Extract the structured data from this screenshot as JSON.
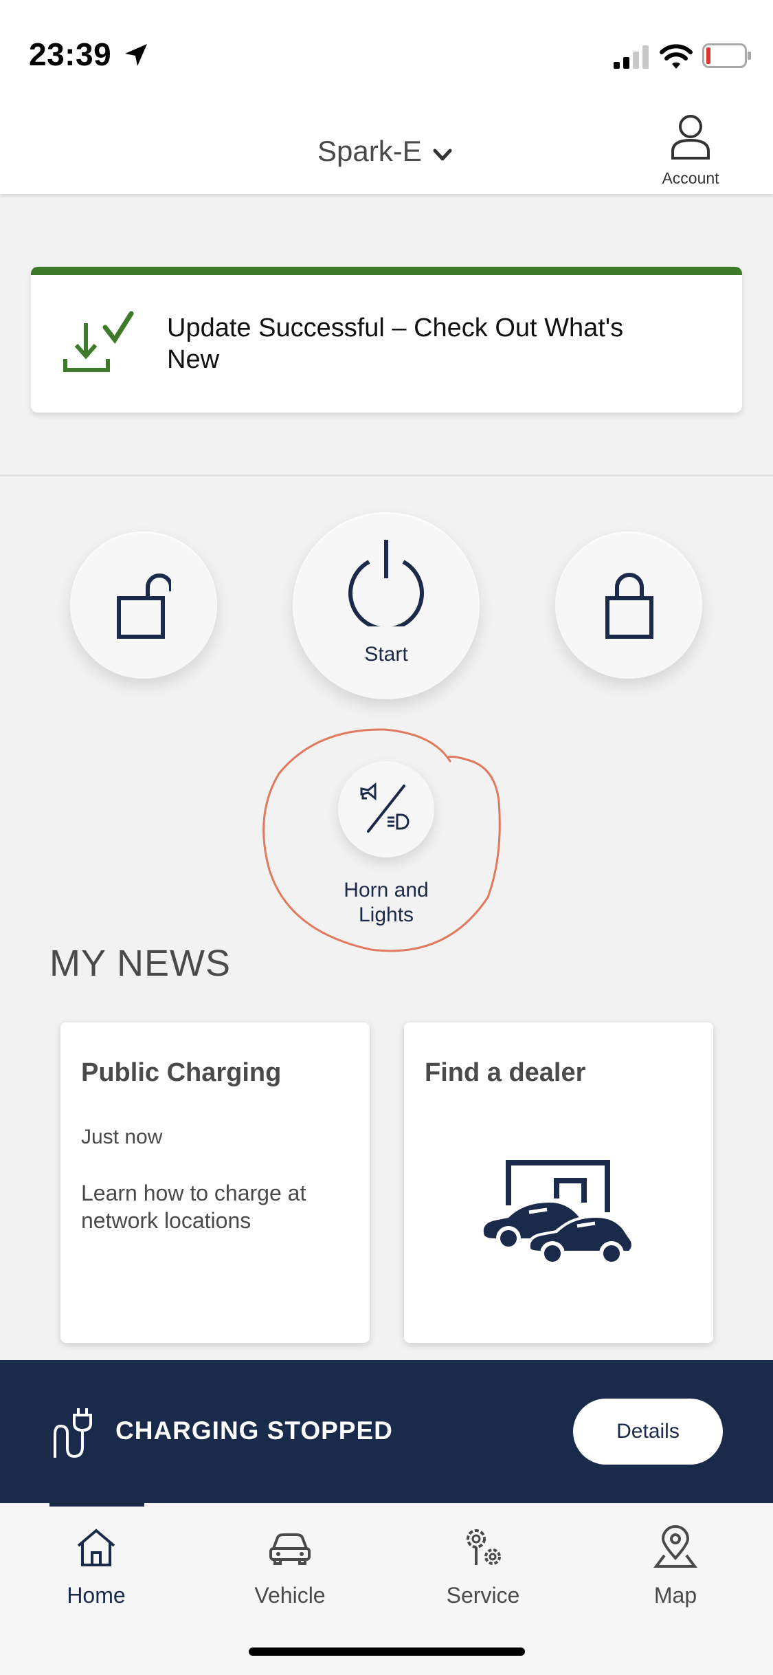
{
  "status_bar": {
    "time": "23:39",
    "icons": [
      "location-arrow-icon",
      "cellular-signal-icon",
      "wifi-icon",
      "battery-low-icon"
    ]
  },
  "header": {
    "vehicle_name": "Spark-E",
    "account_label": "Account"
  },
  "update_banner": {
    "text": "Update Successful – Check Out What's New",
    "accent_color": "#3d7a29",
    "icon": "download-check-icon"
  },
  "controls": {
    "unlock": {
      "icon": "unlock-icon"
    },
    "start": {
      "label": "Start",
      "icon": "power-icon"
    },
    "lock": {
      "icon": "lock-icon"
    },
    "horn": {
      "label": "Horn and Lights",
      "icon": "horn-lights-icon"
    }
  },
  "news": {
    "title": "MY NEWS",
    "cards": [
      {
        "title": "Public Charging",
        "time": "Just now",
        "body": "Learn how to charge at network locations"
      },
      {
        "title": "Find a dealer",
        "icon": "dealership-cars-icon"
      }
    ]
  },
  "charging": {
    "status": "CHARGING STOPPED",
    "details_label": "Details",
    "bg_color": "#1a2a4a"
  },
  "nav": {
    "items": [
      {
        "label": "Home",
        "icon": "home-icon",
        "active": true
      },
      {
        "label": "Vehicle",
        "icon": "car-icon"
      },
      {
        "label": "Service",
        "icon": "service-gears-icon"
      },
      {
        "label": "Map",
        "icon": "map-pin-icon"
      }
    ]
  }
}
